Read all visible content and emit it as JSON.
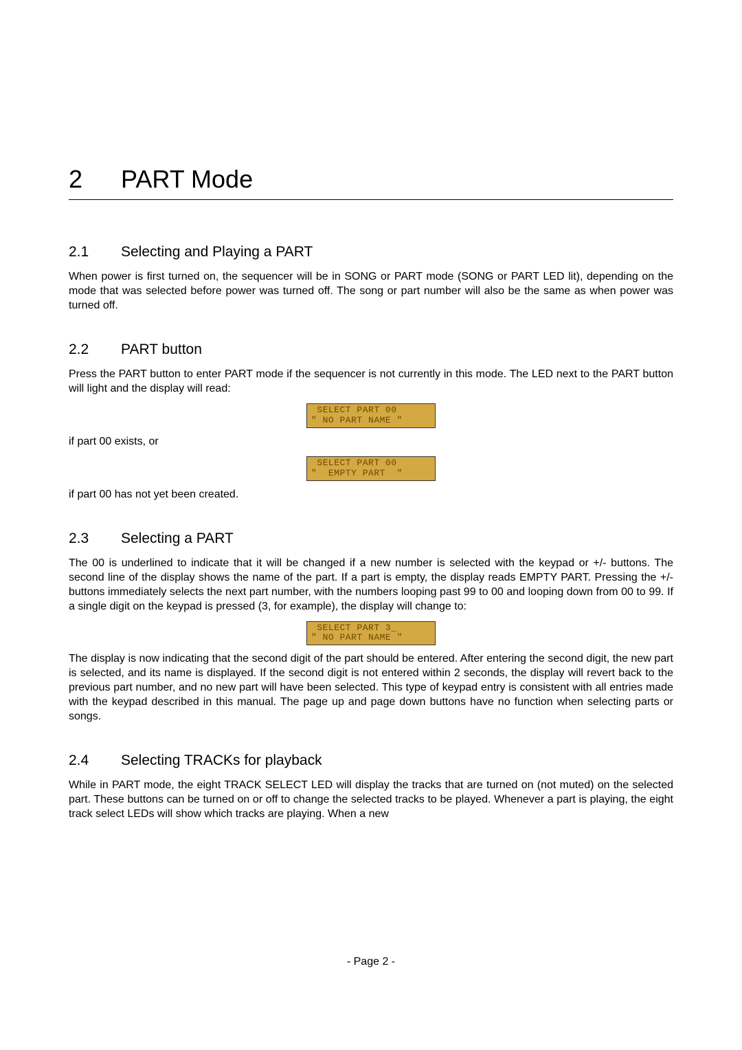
{
  "chapter": {
    "number": "2",
    "title": "PART Mode"
  },
  "sections": {
    "s21": {
      "num": "2.1",
      "title": "Selecting and Playing a PART",
      "p1": "When power is first turned on, the sequencer will be in SONG or PART mode (SONG or PART LED lit), depending on the mode that was selected before power was turned off. The song or part number will also be the same as when power was turned off."
    },
    "s22": {
      "num": "2.2",
      "title": "PART button",
      "p1": "Press the PART button to enter PART mode if the sequencer is not currently in this mode. The LED next to the PART button will light and the display will read:",
      "lcd1": " SELECT PART 00 \n\" NO PART NAME \"",
      "p2": "if part 00 exists, or",
      "lcd2": " SELECT PART 00 \n\"  EMPTY PART  \"",
      "p3": "if part 00 has not yet been created."
    },
    "s23": {
      "num": "2.3",
      "title": "Selecting a PART",
      "p1": "The 00 is underlined to indicate that it will be changed if a new number is selected with the keypad or +/- buttons. The second line of the display shows the name of the part. If a part is empty, the display reads EMPTY PART. Pressing the +/- buttons immediately selects the next part number, with the numbers looping past 99 to 00 and looping down from 00 to 99. If a single digit on the keypad is pressed (3, for example), the display will change to:",
      "lcd1": " SELECT PART 3_ \n\" NO PART NAME \"",
      "p2": "The display is now indicating that the second digit of the part should be entered. After entering the second digit, the new part is selected, and its name is displayed. If the second digit is not entered within 2 seconds, the display will revert back to the previous part number, and no new part will have been selected. This type of keypad entry is consistent with all entries made with the keypad described in this manual. The page up and page down buttons have no function when selecting parts or songs."
    },
    "s24": {
      "num": "2.4",
      "title": "Selecting TRACKs for playback",
      "p1": "While in PART mode, the eight TRACK SELECT LED will display the tracks that are turned on (not muted) on the selected part. These buttons can be turned on or off to change the selected tracks to be played. Whenever a part is playing, the eight track select LEDs will show which tracks are playing. When a new"
    }
  },
  "footer": "- Page 2 -"
}
